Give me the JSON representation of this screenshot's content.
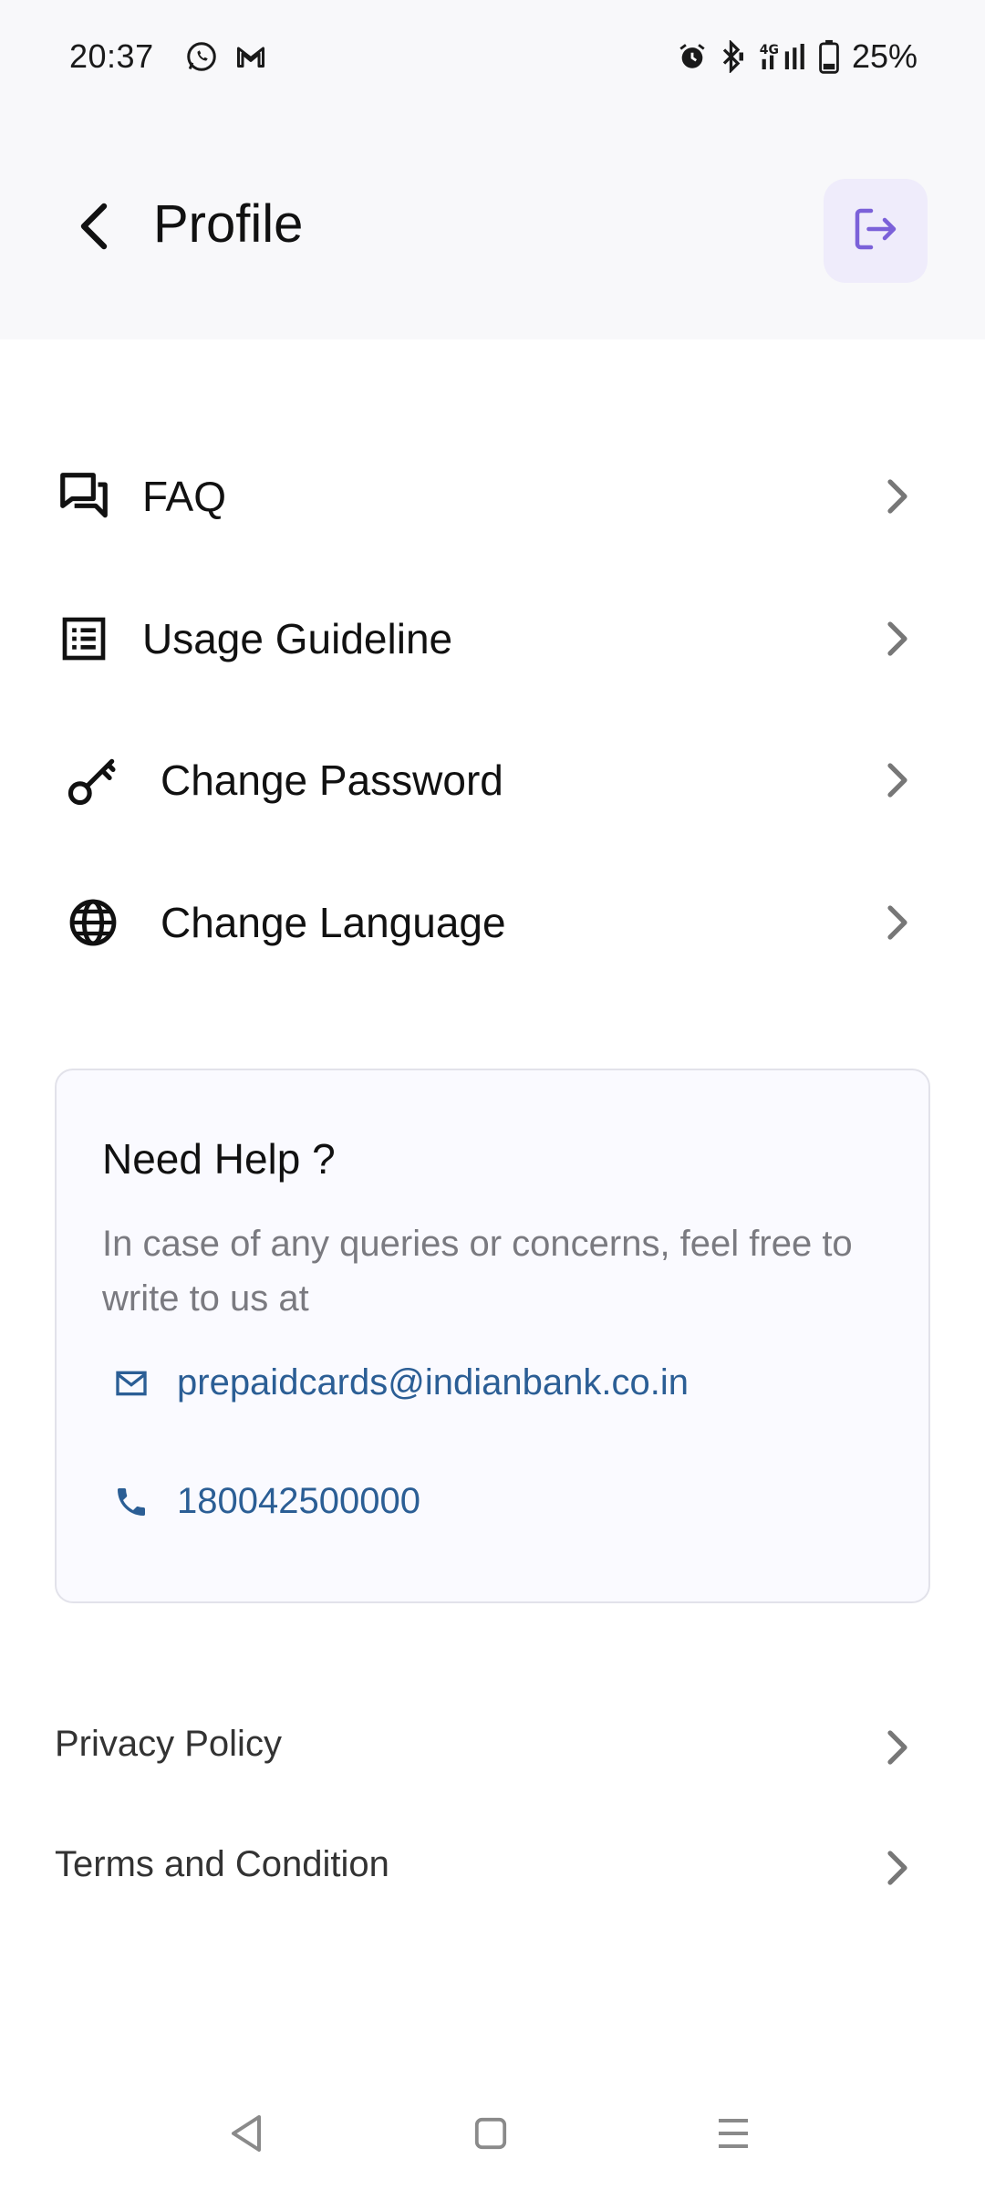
{
  "status_bar": {
    "time": "20:37",
    "battery": "25%",
    "icons": [
      "whatsapp-icon",
      "gmail-icon",
      "alarm-icon",
      "bluetooth-icon",
      "network-4g-icon",
      "signal-icon",
      "battery-icon"
    ]
  },
  "header": {
    "title": "Profile",
    "back_icon": "chevron-left-icon",
    "logout_icon": "logout-icon",
    "accent_color": "#7b61d9"
  },
  "menu": [
    {
      "label": "FAQ",
      "icon": "forum-icon"
    },
    {
      "label": "Usage Guideline",
      "icon": "list-alt-icon"
    },
    {
      "label": "Change Password",
      "icon": "key-icon"
    },
    {
      "label": "Change Language",
      "icon": "globe-icon"
    }
  ],
  "help": {
    "title": "Need Help ?",
    "description": "In case of any queries or concerns, feel free to write to us at",
    "email": "prepaidcards@indianbank.co.in",
    "phone": "180042500000",
    "link_color": "#2b5e95"
  },
  "links": [
    {
      "label": "Privacy Policy"
    },
    {
      "label": "Terms and Condition"
    }
  ],
  "navbar": {
    "icons": [
      "back-triangle-icon",
      "home-square-icon",
      "menu-lines-icon"
    ]
  }
}
